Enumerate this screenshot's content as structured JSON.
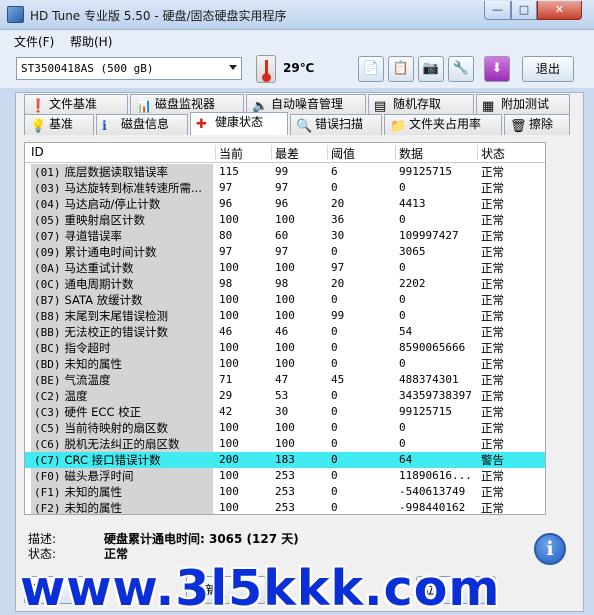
{
  "window": {
    "title": "HD Tune 专业版 5.50 - 硬盘/固态硬盘实用程序",
    "min": "—",
    "max": "□",
    "close": "✕"
  },
  "menu": {
    "file": "文件(F)",
    "help": "帮助(H)"
  },
  "toolbar": {
    "drive": "ST3500418AS (500 gB)",
    "temperature": "29℃",
    "exit_label": "退出",
    "icons": [
      "copy-icon",
      "copy-all-icon",
      "camera-icon",
      "options-icon",
      "save-icon"
    ]
  },
  "tabs_row1": [
    "文件基准",
    "磁盘监视器",
    "自动噪音管理",
    "随机存取",
    "附加测试"
  ],
  "tabs_row2": [
    "基准",
    "磁盘信息",
    "健康状态",
    "错误扫描",
    "文件夹占用率",
    "擦除"
  ],
  "columns": {
    "id": "ID",
    "current": "当前",
    "worst": "最差",
    "threshold": "阈值",
    "data": "数据",
    "status": "状态"
  },
  "rows": [
    {
      "id": "(01)",
      "name": "底层数据读取错误率",
      "current": "115",
      "worst": "99",
      "threshold": "6",
      "data": "99125715",
      "status": "正常"
    },
    {
      "id": "(03)",
      "name": "马达旋转到标准转速所需...",
      "current": "97",
      "worst": "97",
      "threshold": "0",
      "data": "0",
      "status": "正常"
    },
    {
      "id": "(04)",
      "name": "马达启动/停止计数",
      "current": "96",
      "worst": "96",
      "threshold": "20",
      "data": "4413",
      "status": "正常"
    },
    {
      "id": "(05)",
      "name": "重映射扇区计数",
      "current": "100",
      "worst": "100",
      "threshold": "36",
      "data": "0",
      "status": "正常"
    },
    {
      "id": "(07)",
      "name": "寻道错误率",
      "current": "80",
      "worst": "60",
      "threshold": "30",
      "data": "109997427",
      "status": "正常"
    },
    {
      "id": "(09)",
      "name": "累计通电时间计数",
      "current": "97",
      "worst": "97",
      "threshold": "0",
      "data": "3065",
      "status": "正常"
    },
    {
      "id": "(0A)",
      "name": "马达重试计数",
      "current": "100",
      "worst": "100",
      "threshold": "97",
      "data": "0",
      "status": "正常"
    },
    {
      "id": "(0C)",
      "name": "通电周期计数",
      "current": "98",
      "worst": "98",
      "threshold": "20",
      "data": "2202",
      "status": "正常"
    },
    {
      "id": "(B7)",
      "name": "SATA 放缓计数",
      "current": "100",
      "worst": "100",
      "threshold": "0",
      "data": "0",
      "status": "正常"
    },
    {
      "id": "(B8)",
      "name": "末尾到末尾错误检测",
      "current": "100",
      "worst": "100",
      "threshold": "99",
      "data": "0",
      "status": "正常"
    },
    {
      "id": "(BB)",
      "name": "无法校正的错误计数",
      "current": "46",
      "worst": "46",
      "threshold": "0",
      "data": "54",
      "status": "正常"
    },
    {
      "id": "(BC)",
      "name": "指令超时",
      "current": "100",
      "worst": "100",
      "threshold": "0",
      "data": "8590065666",
      "status": "正常"
    },
    {
      "id": "(BD)",
      "name": "未知的属性",
      "current": "100",
      "worst": "100",
      "threshold": "0",
      "data": "0",
      "status": "正常"
    },
    {
      "id": "(BE)",
      "name": "气流温度",
      "current": "71",
      "worst": "47",
      "threshold": "45",
      "data": "488374301",
      "status": "正常"
    },
    {
      "id": "(C2)",
      "name": "温度",
      "current": "29",
      "worst": "53",
      "threshold": "0",
      "data": "34359738397",
      "status": "正常"
    },
    {
      "id": "(C3)",
      "name": "硬件 ECC 校正",
      "current": "42",
      "worst": "30",
      "threshold": "0",
      "data": "99125715",
      "status": "正常"
    },
    {
      "id": "(C5)",
      "name": "当前待映射的扇区数",
      "current": "100",
      "worst": "100",
      "threshold": "0",
      "data": "0",
      "status": "正常"
    },
    {
      "id": "(C6)",
      "name": "脱机无法纠正的扇区数",
      "current": "100",
      "worst": "100",
      "threshold": "0",
      "data": "0",
      "status": "正常"
    },
    {
      "id": "(C7)",
      "name": "CRC 接口错误计数",
      "current": "200",
      "worst": "183",
      "threshold": "0",
      "data": "64",
      "status": "警告"
    },
    {
      "id": "(F0)",
      "name": "磁头悬浮时间",
      "current": "100",
      "worst": "253",
      "threshold": "0",
      "data": "11890616...",
      "status": "正常"
    },
    {
      "id": "(F1)",
      "name": "未知的属性",
      "current": "100",
      "worst": "253",
      "threshold": "0",
      "data": "-540613749",
      "status": "正常"
    },
    {
      "id": "(F2)",
      "name": "未知的属性",
      "current": "100",
      "worst": "253",
      "threshold": "0",
      "data": "-998440162",
      "status": "正常"
    }
  ],
  "description": {
    "label": "描述:",
    "value": "硬盘累计通电时间: 3065 (127 天)"
  },
  "health": {
    "label": "状态:",
    "value": "正常"
  },
  "info_icon": "i",
  "bottom_buttons": [
    "保",
    "刷新",
    "立即"
  ],
  "watermark": "www.3l5kkk.com",
  "colors": {
    "warning_row": "#40ebf2",
    "watermark": "#0a2fd6"
  }
}
